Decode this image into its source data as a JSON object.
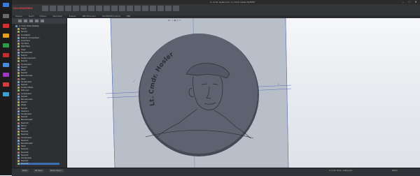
{
  "window": {
    "title": "Lt. Cmdr. Hosler part - Lt. Cmdr. Hosler.SLDPRT",
    "minimize": "–",
    "maximize": "□",
    "close": "✕"
  },
  "app": {
    "logo_text": "SOLIDWORKS"
  },
  "ribbon": {
    "tools": [
      "Extruded Boss/Base",
      "Revolved Boss/Base",
      "Swept Boss/Base",
      "Lofted Boss/Base",
      "Boundary Boss/Base",
      "Extruded Cut",
      "Hole Wizard",
      "Revolved Cut",
      "Fillet",
      "Linear Pattern",
      "Rib",
      "Draft",
      "Shell",
      "Wrap",
      "Intersect",
      "Reference Geometry",
      "Curves",
      "Instant3D"
    ]
  },
  "tabs": [
    "Features",
    "Sketch",
    "Surfaces",
    "Sheet Metal",
    "Evaluate",
    "MBD Dimensions",
    "SOLIDWORKS Add-Ins",
    "MBD"
  ],
  "tree": [
    "Lt. Cmdr. Hosler (Default)",
    "History",
    "Sensors",
    "Annotations",
    "Material <not specified>",
    "Front Plane",
    "Top Plane",
    "Right Plane",
    "Origin",
    "Boss-Extrude1",
    "Sketch1",
    "Surface-Imported1",
    "Sketch2",
    "Cut-Extrude1",
    "Sketch3",
    "Wrap1",
    "Sketch4",
    "Boss-Extrude2",
    "Fillet1",
    "Cut-Extrude2",
    "Sketch5",
    "Surface-Offset1",
    "Split Line1",
    "Cut-Extrude3",
    "Sketch6",
    "Boss-Extrude3",
    "Sketch7",
    "Wrap2",
    "Sketch8",
    "Chamfer1",
    "Cut-Extrude4",
    "Sketch9",
    "Boss-Extrude4",
    "Sketch10",
    "Mirror1",
    "Fillet2",
    "Sketch11",
    "Sketch12",
    "Cut-Extrude5",
    "Sketch13",
    "Boss-Extrude5",
    "Fillet3",
    "Sketch14",
    "Sketch15",
    "Sketch16",
    "Cut-Extrude6",
    "Sketch17",
    "Sketch18"
  ],
  "model": {
    "engraved_text": "Lt. Cmdr. Hosler"
  },
  "status": {
    "tabs": [
      "Model",
      "3D Views",
      "Motion Study 1"
    ],
    "text": "Lt. Cmdr. Hosler - Editing Part",
    "units": "MMGS"
  },
  "colors": {
    "coin_face": "#5d6270",
    "coin_rim": "#444955",
    "plane": "#b9bfc9",
    "accent": "#3d6fb0"
  }
}
